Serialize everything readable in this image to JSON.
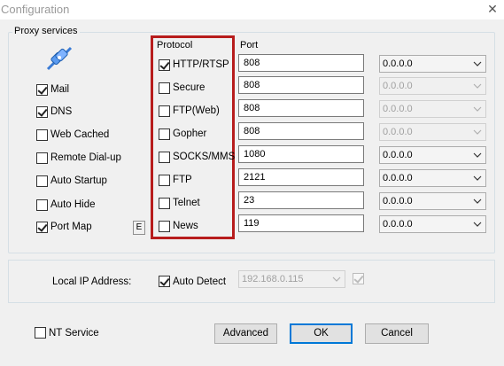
{
  "window": {
    "title": "Configuration",
    "close_glyph": "✕"
  },
  "proxy_services": {
    "label": "Proxy services",
    "icon": "network-plug-icon",
    "services": [
      {
        "label": "Mail",
        "checked": true
      },
      {
        "label": "DNS",
        "checked": true
      },
      {
        "label": "Web Cached",
        "checked": false
      },
      {
        "label": "Remote Dial-up",
        "checked": false
      },
      {
        "label": "Auto Startup",
        "checked": false
      },
      {
        "label": "Auto Hide",
        "checked": false
      },
      {
        "label": "Port Map",
        "checked": true
      }
    ],
    "port_map_edit_label": "E"
  },
  "protocols": {
    "header": "Protocol",
    "port_header": "Port",
    "rows": [
      {
        "label": "HTTP/RTSP",
        "checked": true,
        "port": "808",
        "address": "0.0.0.0",
        "address_enabled": true
      },
      {
        "label": "Secure",
        "checked": false,
        "port": "808",
        "address": "0.0.0.0",
        "address_enabled": false
      },
      {
        "label": "FTP(Web)",
        "checked": false,
        "port": "808",
        "address": "0.0.0.0",
        "address_enabled": false
      },
      {
        "label": "Gopher",
        "checked": false,
        "port": "808",
        "address": "0.0.0.0",
        "address_enabled": false
      },
      {
        "label": "SOCKS/MMS",
        "checked": false,
        "port": "1080",
        "address": "0.0.0.0",
        "address_enabled": true
      },
      {
        "label": "FTP",
        "checked": false,
        "port": "2121",
        "address": "0.0.0.0",
        "address_enabled": true
      },
      {
        "label": "Telnet",
        "checked": false,
        "port": "23",
        "address": "0.0.0.0",
        "address_enabled": true
      },
      {
        "label": "News",
        "checked": false,
        "port": "119",
        "address": "0.0.0.0",
        "address_enabled": true
      }
    ]
  },
  "local_ip": {
    "label": "Local IP Address:",
    "auto_detect_label": "Auto Detect",
    "auto_detect_checked": true,
    "ip_value": "192.168.0.115",
    "extra_checkbox_checked": true
  },
  "footer": {
    "nt_service_label": "NT Service",
    "nt_service_checked": false,
    "advanced_label": "Advanced",
    "ok_label": "OK",
    "cancel_label": "Cancel"
  },
  "colors": {
    "highlight_border": "#b71c1c",
    "default_button_border": "#0078d7"
  }
}
